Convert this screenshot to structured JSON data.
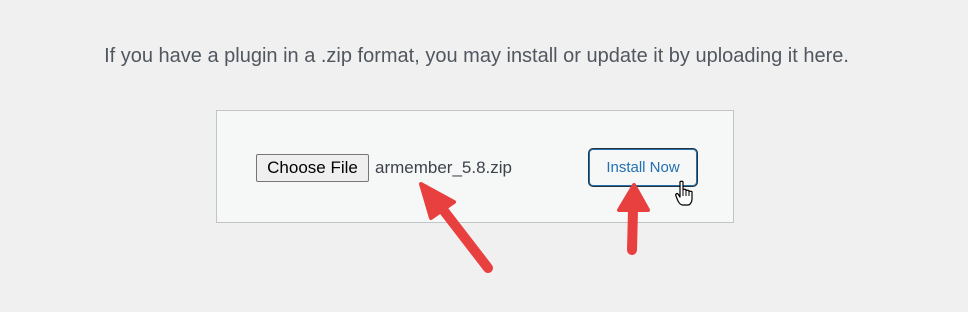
{
  "upload": {
    "instructions": "If you have a plugin in a .zip format, you may install or update it by uploading it here.",
    "choose_file_label": "Choose File",
    "selected_file": "armember_5.8.zip",
    "install_label": "Install Now"
  },
  "colors": {
    "page_background": "#f0f0f1",
    "panel_background": "#f6f7f7",
    "button_accent": "#2271b1",
    "annotation_arrow": "#e8403f"
  },
  "annotations": {
    "arrows": [
      "arrow-to-file-name",
      "arrow-to-install-button"
    ],
    "cursor": "hand-pointer-icon"
  }
}
